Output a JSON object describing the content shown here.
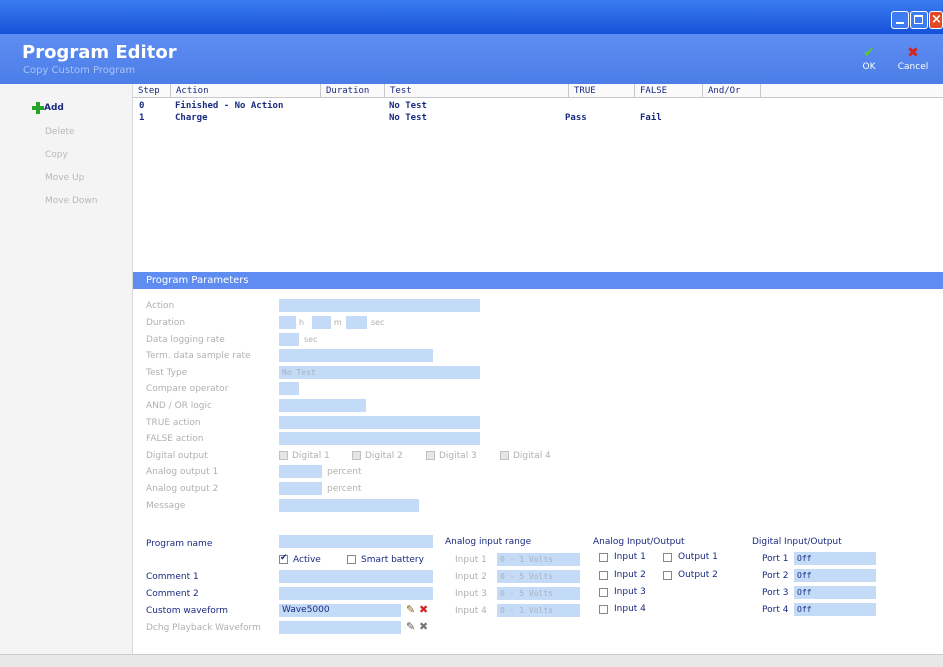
{
  "header": {
    "title": "Program Editor",
    "subtitle": "Copy Custom Program",
    "ok_label": "OK",
    "cancel_label": "Cancel"
  },
  "sidebar": {
    "items": [
      {
        "label": "Add"
      },
      {
        "label": "Delete"
      },
      {
        "label": "Copy"
      },
      {
        "label": "Move Up"
      },
      {
        "label": "Move Down"
      }
    ]
  },
  "grid": {
    "columns": [
      "Step",
      "Action",
      "Duration",
      "Test",
      "TRUE",
      "FALSE",
      "And/Or"
    ],
    "rows": [
      {
        "step": "0",
        "action": "Finished - No Action",
        "duration": "",
        "test": "No Test",
        "true": "",
        "false": "",
        "andor": ""
      },
      {
        "step": "1",
        "action": "Charge",
        "duration": "",
        "test": "No Test",
        "true": "Pass",
        "false": "Fail",
        "andor": ""
      }
    ]
  },
  "params": {
    "header": "Program Parameters",
    "labels": [
      "Action",
      "Duration",
      "Data logging rate",
      "Term. data sample rate",
      "Test Type",
      "Compare operator",
      "AND / OR logic",
      "TRUE action",
      "FALSE action",
      "Digital output",
      "Analog output 1",
      "Analog output 2",
      "Message"
    ],
    "duration_h": "h",
    "duration_m": "m",
    "duration_sec": "sec",
    "logging_sec": "sec",
    "test_type_value": "No Test",
    "digital_outputs": [
      "Digital 1",
      "Digital 2",
      "Digital 3",
      "Digital 4"
    ],
    "percent": "percent"
  },
  "program": {
    "name_label": "Program name",
    "active_label": "Active",
    "smart_battery_label": "Smart battery",
    "comment1_label": "Comment 1",
    "comment2_label": "Comment 2",
    "custom_waveform_label": "Custom waveform",
    "custom_waveform_value": "Wave5000",
    "dchg_label": "Dchg Playback Waveform"
  },
  "analog_range": {
    "title": "Analog input range",
    "inputs": [
      {
        "label": "Input 1",
        "value": "0 - 1 Volts"
      },
      {
        "label": "Input 2",
        "value": "0 - 5 Volts"
      },
      {
        "label": "Input 3",
        "value": "0 - 5 Volts"
      },
      {
        "label": "Input 4",
        "value": "0 - 1 Volts"
      }
    ]
  },
  "analog_io": {
    "title": "Analog Input/Output",
    "items": [
      "Input 1",
      "Output 1",
      "Input 2",
      "Output 2",
      "Input 3",
      "Input 4"
    ]
  },
  "digital_io": {
    "title": "Digital Input/Output",
    "ports": [
      {
        "label": "Port 1",
        "value": "Off"
      },
      {
        "label": "Port 2",
        "value": "Off"
      },
      {
        "label": "Port 3",
        "value": "Off"
      },
      {
        "label": "Port 4",
        "value": "Off"
      }
    ]
  },
  "colors": {
    "titlebar": "#1652d8",
    "header": "#4b7ee8",
    "accent_text": "#1a2a80",
    "field": "#c4dbf8",
    "ok_green": "#3aa53a",
    "cancel_red": "#d42424"
  }
}
